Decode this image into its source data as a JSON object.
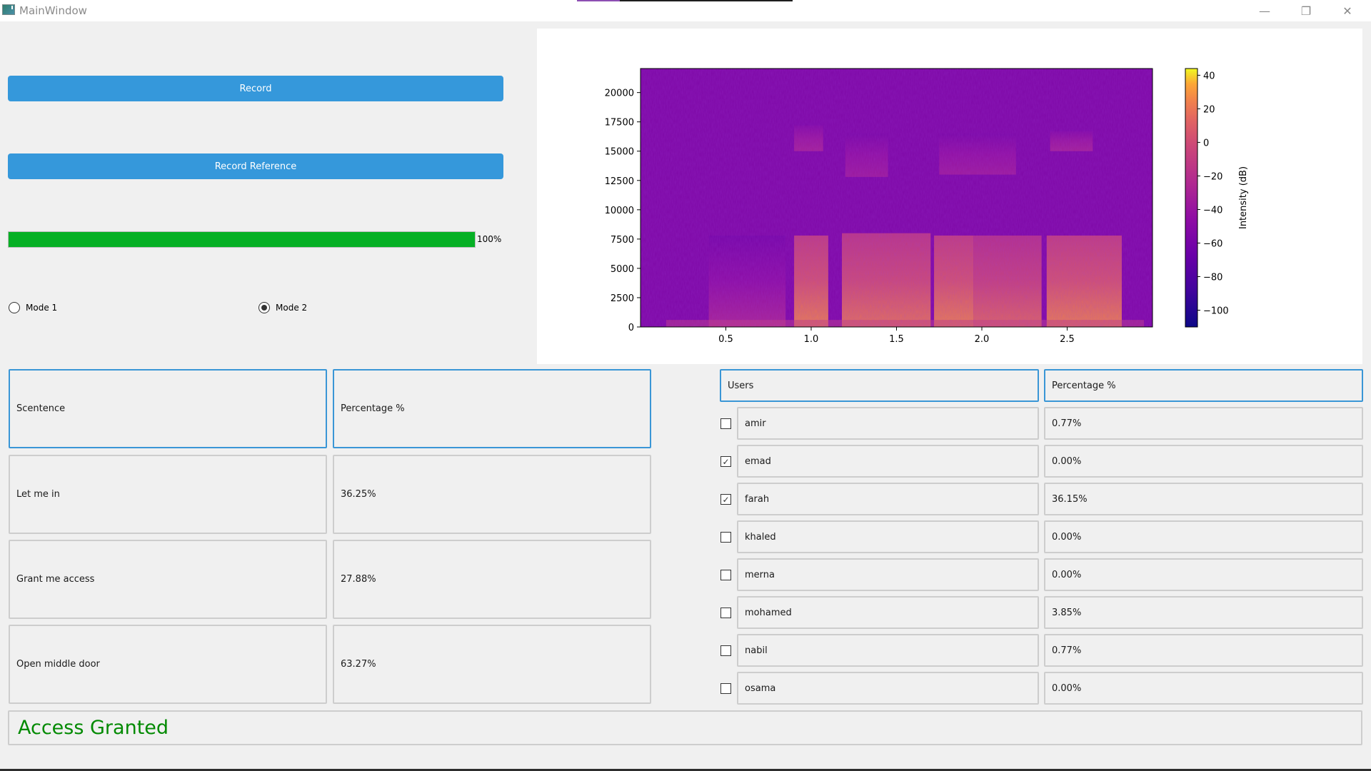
{
  "window": {
    "title": "MainWindow",
    "icon": "app-window-icon",
    "controls": {
      "minimize": "—",
      "restore": "❐",
      "close": "✕"
    }
  },
  "controls": {
    "record_label": "Record",
    "record_reference_label": "Record Reference",
    "progress": {
      "value_percent": 100,
      "text": "100%",
      "color": "#06b025"
    },
    "modes": [
      {
        "label": "Mode 1",
        "checked": false
      },
      {
        "label": "Mode 2",
        "checked": true
      }
    ],
    "accent_color": "#3598db"
  },
  "sentence_table": {
    "headers": [
      "Scentence",
      "Percentage %"
    ],
    "rows": [
      {
        "sentence": "Let me in",
        "percentage": "36.25%"
      },
      {
        "sentence": "Grant me access",
        "percentage": "27.88%"
      },
      {
        "sentence": "Open middle door",
        "percentage": "63.27%"
      }
    ]
  },
  "users_table": {
    "headers": [
      "Users",
      "Percentage %"
    ],
    "rows": [
      {
        "name": "amir",
        "percentage": "0.77%",
        "checked": false
      },
      {
        "name": "emad",
        "percentage": "0.00%",
        "checked": true
      },
      {
        "name": "farah",
        "percentage": "36.15%",
        "checked": true
      },
      {
        "name": "khaled",
        "percentage": "0.00%",
        "checked": false
      },
      {
        "name": "merna",
        "percentage": "0.00%",
        "checked": false
      },
      {
        "name": "mohamed",
        "percentage": "3.85%",
        "checked": false
      },
      {
        "name": "nabil",
        "percentage": "0.77%",
        "checked": false
      },
      {
        "name": "osama",
        "percentage": "0.00%",
        "checked": false
      }
    ]
  },
  "status": {
    "text": "Access Granted",
    "color": "#028a02"
  },
  "chart_data": {
    "type": "heatmap",
    "title": "",
    "xlabel": "",
    "ylabel": "",
    "xlim": [
      0,
      3.0
    ],
    "ylim": [
      0,
      22050
    ],
    "x_ticks": [
      0.5,
      1.0,
      1.5,
      2.0,
      2.5
    ],
    "x_tick_labels": [
      "0.5",
      "1.0",
      "1.5",
      "2.0",
      "2.5"
    ],
    "y_ticks": [
      0,
      2500,
      5000,
      7500,
      10000,
      12500,
      15000,
      17500,
      20000
    ],
    "y_tick_labels": [
      "0",
      "2500",
      "5000",
      "7500",
      "10000",
      "12500",
      "15000",
      "17500",
      "20000"
    ],
    "colormap": "plasma",
    "colorbar": {
      "label": "Intensity (dB)",
      "range": [
        -110,
        44
      ],
      "ticks": [
        40,
        20,
        0,
        -20,
        -40,
        -60,
        -80,
        -100
      ],
      "tick_labels": [
        "40",
        "20",
        "0",
        "−20",
        "−40",
        "−60",
        "−80",
        "−100"
      ]
    },
    "background_level_db": -55,
    "energy_regions": [
      {
        "t_start": 0.4,
        "t_end": 0.85,
        "f_max": 7800,
        "level_db": -38
      },
      {
        "t_start": 0.9,
        "t_end": 1.1,
        "f_max": 7800,
        "level_db": 15
      },
      {
        "t_start": 1.18,
        "t_end": 1.7,
        "f_max": 8000,
        "level_db": 10
      },
      {
        "t_start": 1.72,
        "t_end": 1.95,
        "f_max": 7800,
        "level_db": 15
      },
      {
        "t_start": 1.95,
        "t_end": 2.35,
        "f_max": 7800,
        "level_db": 5
      },
      {
        "t_start": 2.38,
        "t_end": 2.82,
        "f_max": 7800,
        "level_db": 15
      },
      {
        "t_start": 0.9,
        "t_end": 1.07,
        "f_min": 15000,
        "f_max": 17200,
        "level_db": -30
      },
      {
        "t_start": 1.2,
        "t_end": 1.45,
        "f_min": 12800,
        "f_max": 16500,
        "level_db": -35
      },
      {
        "t_start": 1.75,
        "t_end": 2.2,
        "f_min": 13000,
        "f_max": 16500,
        "level_db": -35
      },
      {
        "t_start": 2.4,
        "t_end": 2.65,
        "f_min": 15000,
        "f_max": 16700,
        "level_db": -30
      }
    ]
  }
}
